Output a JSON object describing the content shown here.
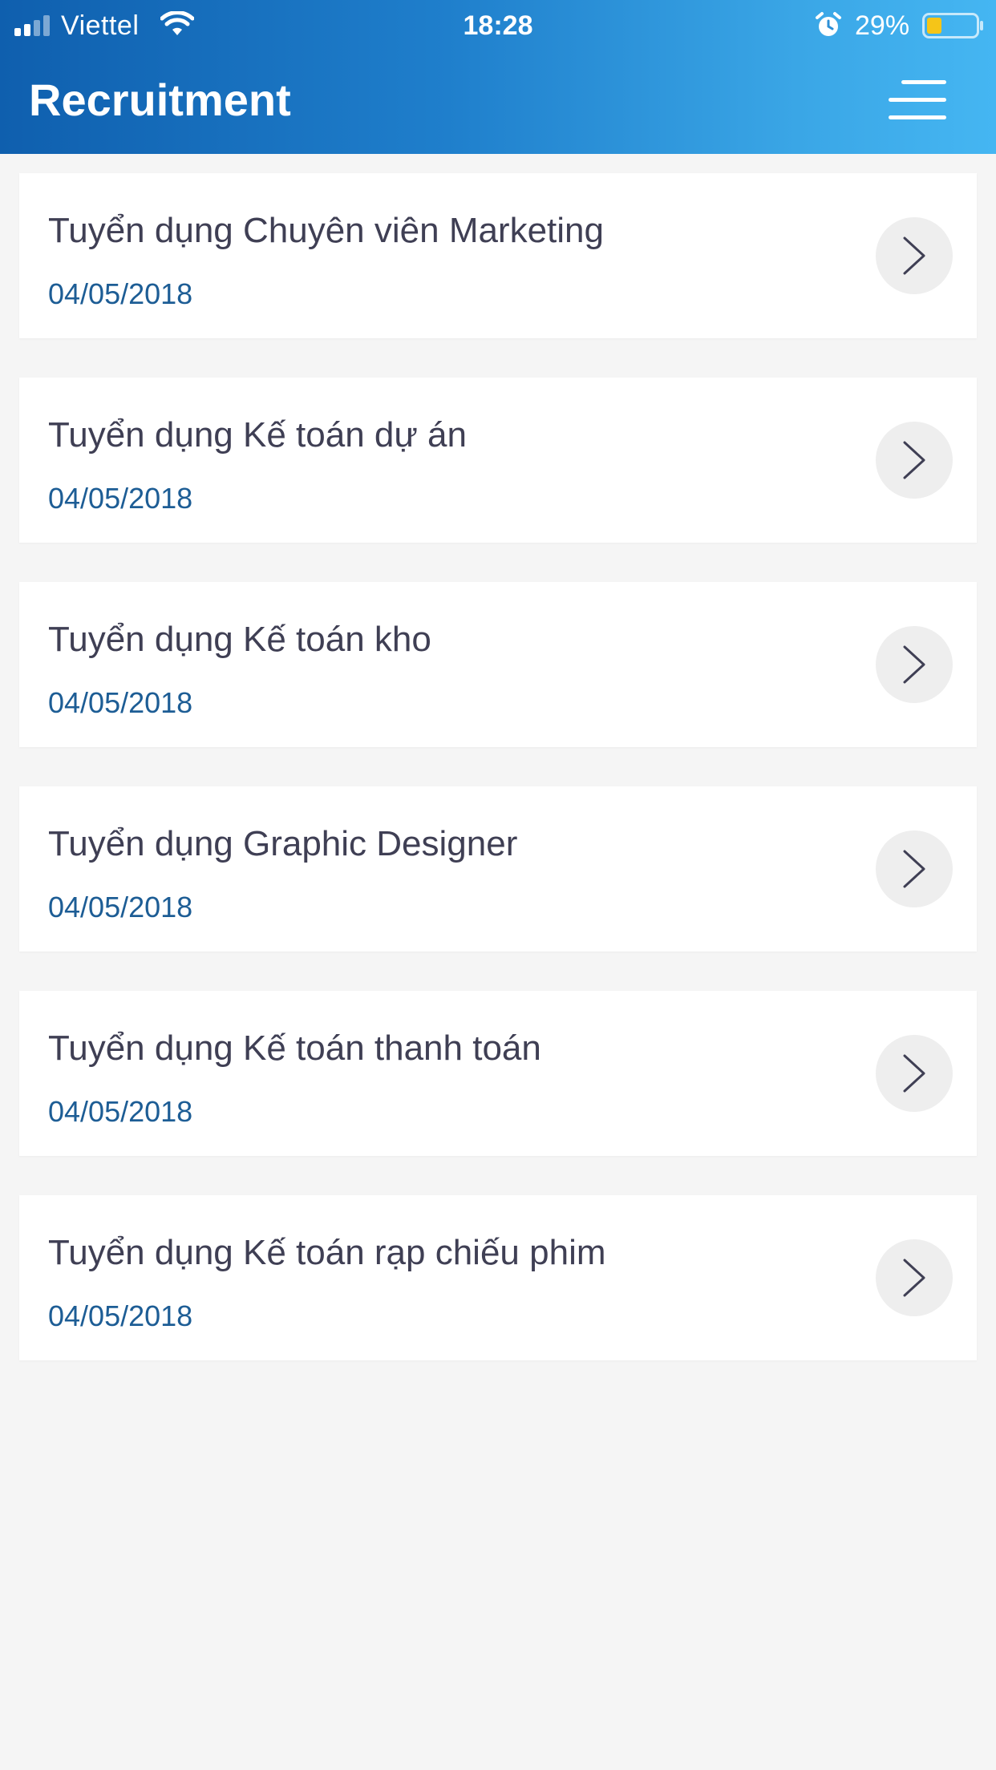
{
  "status_bar": {
    "carrier": "Viettel",
    "time": "18:28",
    "battery_percent": "29%"
  },
  "header": {
    "title": "Recruitment"
  },
  "jobs": [
    {
      "title": "Tuyển dụng Chuyên viên Marketing",
      "date": "04/05/2018"
    },
    {
      "title": "Tuyển dụng Kế toán dự án",
      "date": "04/05/2018"
    },
    {
      "title": "Tuyển dụng Kế toán kho",
      "date": "04/05/2018"
    },
    {
      "title": "Tuyển dụng Graphic Designer",
      "date": "04/05/2018"
    },
    {
      "title": "Tuyển dụng Kế toán thanh toán",
      "date": "04/05/2018"
    },
    {
      "title": "Tuyển dụng Kế toán rạp chiếu phim",
      "date": "04/05/2018"
    }
  ],
  "colors": {
    "header_gradient_start": "#0f5fae",
    "header_gradient_end": "#45b6f2",
    "title_text": "#3f3f54",
    "date_text": "#1d5d95",
    "background": "#f5f5f5",
    "battery_fill": "#f5c518"
  },
  "icons": {
    "menu": "hamburger-menu-icon",
    "row_action": "chevron-right-icon"
  }
}
